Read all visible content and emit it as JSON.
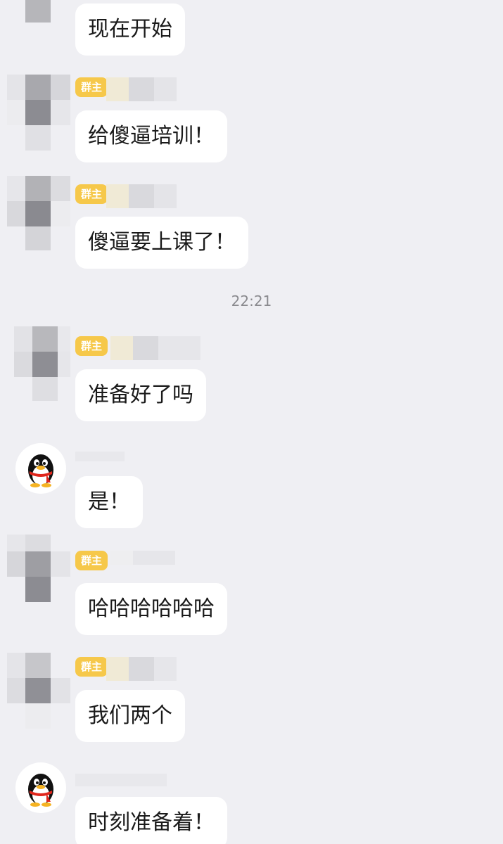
{
  "messages": [
    {
      "text": "现在开始",
      "role_badge": ""
    },
    {
      "text": "给傻逼培训！",
      "role_badge": "群主"
    },
    {
      "text": "傻逼要上课了！",
      "role_badge": "群主"
    },
    {
      "text": "准备好了吗",
      "role_badge": "群主"
    },
    {
      "text": "是！",
      "role_badge": ""
    },
    {
      "text": "哈哈哈哈哈哈",
      "role_badge": "群主"
    },
    {
      "text": "我们两个",
      "role_badge": "群主"
    },
    {
      "text": "时刻准备着！",
      "role_badge": ""
    }
  ],
  "timestamp": "22:21",
  "colors": {
    "background": "#efeff3",
    "bubble": "#ffffff",
    "badge": "#f6c84a",
    "badge_text": "#ffffff",
    "timestamp_text": "#8a8a8e"
  },
  "icons": {
    "owner_avatar": "pixelated-avatar",
    "member_avatar": "qq-penguin-icon"
  }
}
